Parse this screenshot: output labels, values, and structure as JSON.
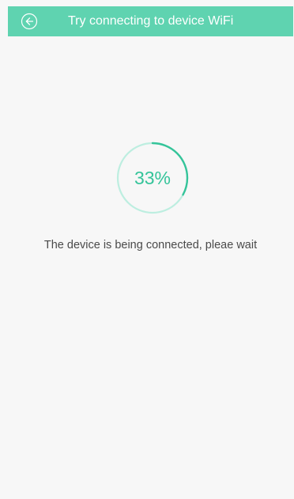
{
  "header": {
    "title": "Try connecting to device WiFi",
    "back_icon": "back-arrow-icon",
    "color": "#5fd3b0"
  },
  "progress": {
    "value": 0.33,
    "label": "33%",
    "track_color": "#bdeee0",
    "fill_color": "#35c49a"
  },
  "status": {
    "message": "The device is being connected, pleae wait"
  }
}
